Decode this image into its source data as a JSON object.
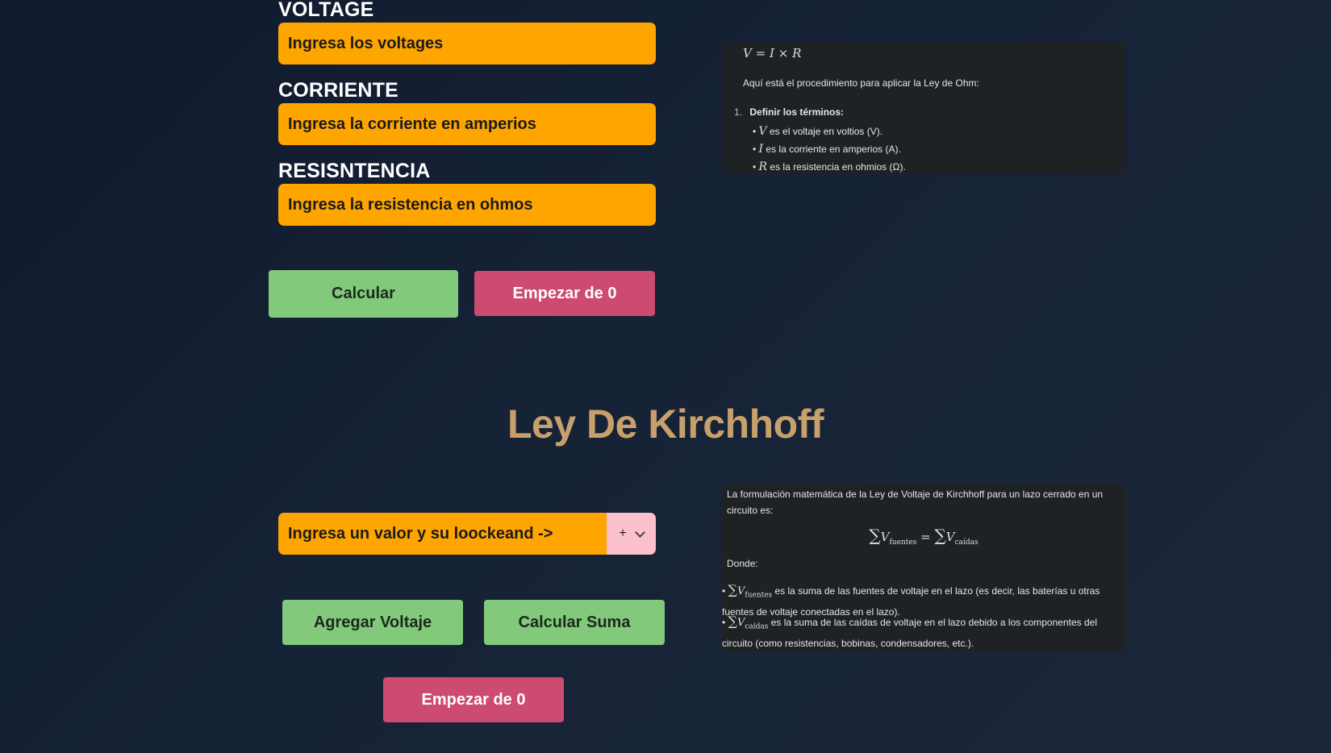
{
  "ohm": {
    "voltage_label": "VOLTAGE",
    "voltage_placeholder": "Ingresa los voltages",
    "current_label": "CORRIENTE",
    "current_placeholder": "Ingresa la corriente en amperios",
    "resistance_label": "RESISNTENCIA",
    "resistance_placeholder": "Ingresa la resistencia en ohmos",
    "calculate_label": "Calcular",
    "reset_label": "Empezar de 0"
  },
  "ohm_panel": {
    "formula_v": "V",
    "formula_eq": "=",
    "formula_i": "I",
    "formula_times": "×",
    "formula_r": "R",
    "intro": "Aquí está el procedimiento para aplicar la Ley de Ohm:",
    "step_number": "1.",
    "step_title": "Definir los términos:",
    "items": [
      {
        "symbol": "V",
        "text": " es el voltaje en voltios (V)."
      },
      {
        "symbol": "I",
        "text": " es la corriente en amperios (A)."
      },
      {
        "symbol": "R",
        "text": " es la resistencia en ohmios (Ω)."
      }
    ]
  },
  "kirchhoff": {
    "title": "Ley De Kirchhoff",
    "value_placeholder": "Ingresa un valor y su loockeand ->",
    "operator_value": "+",
    "add_voltage_label": "Agregar Voltaje",
    "sum_label": "Calcular Suma",
    "reset_label": "Empezar de 0"
  },
  "kirchhoff_panel": {
    "intro": "La formulación matemática de la Ley de Voltaje de Kirchhoff para un lazo cerrado en un circuito es:",
    "sum_symbol": "∑",
    "var": "V",
    "sub_sources": "fuentes",
    "eq": "=",
    "sub_drops": "caídas",
    "where": "Donde:",
    "bullet1_text": " es la suma de las fuentes de voltaje en el lazo (es decir, las baterías u otras fuentes de voltaje conectadas en el lazo).",
    "bullet2_text": " es la suma de las caídas de voltaje en el lazo debido a los componentes del circuito (como resistencias, bobinas, condensadores, etc.)."
  },
  "colors": {
    "input_orange": "#ffa500",
    "button_green": "#83c97c",
    "button_pink": "#cd4a70",
    "title_gold": "#c8a06b",
    "panel_bg": "#1f2225"
  }
}
